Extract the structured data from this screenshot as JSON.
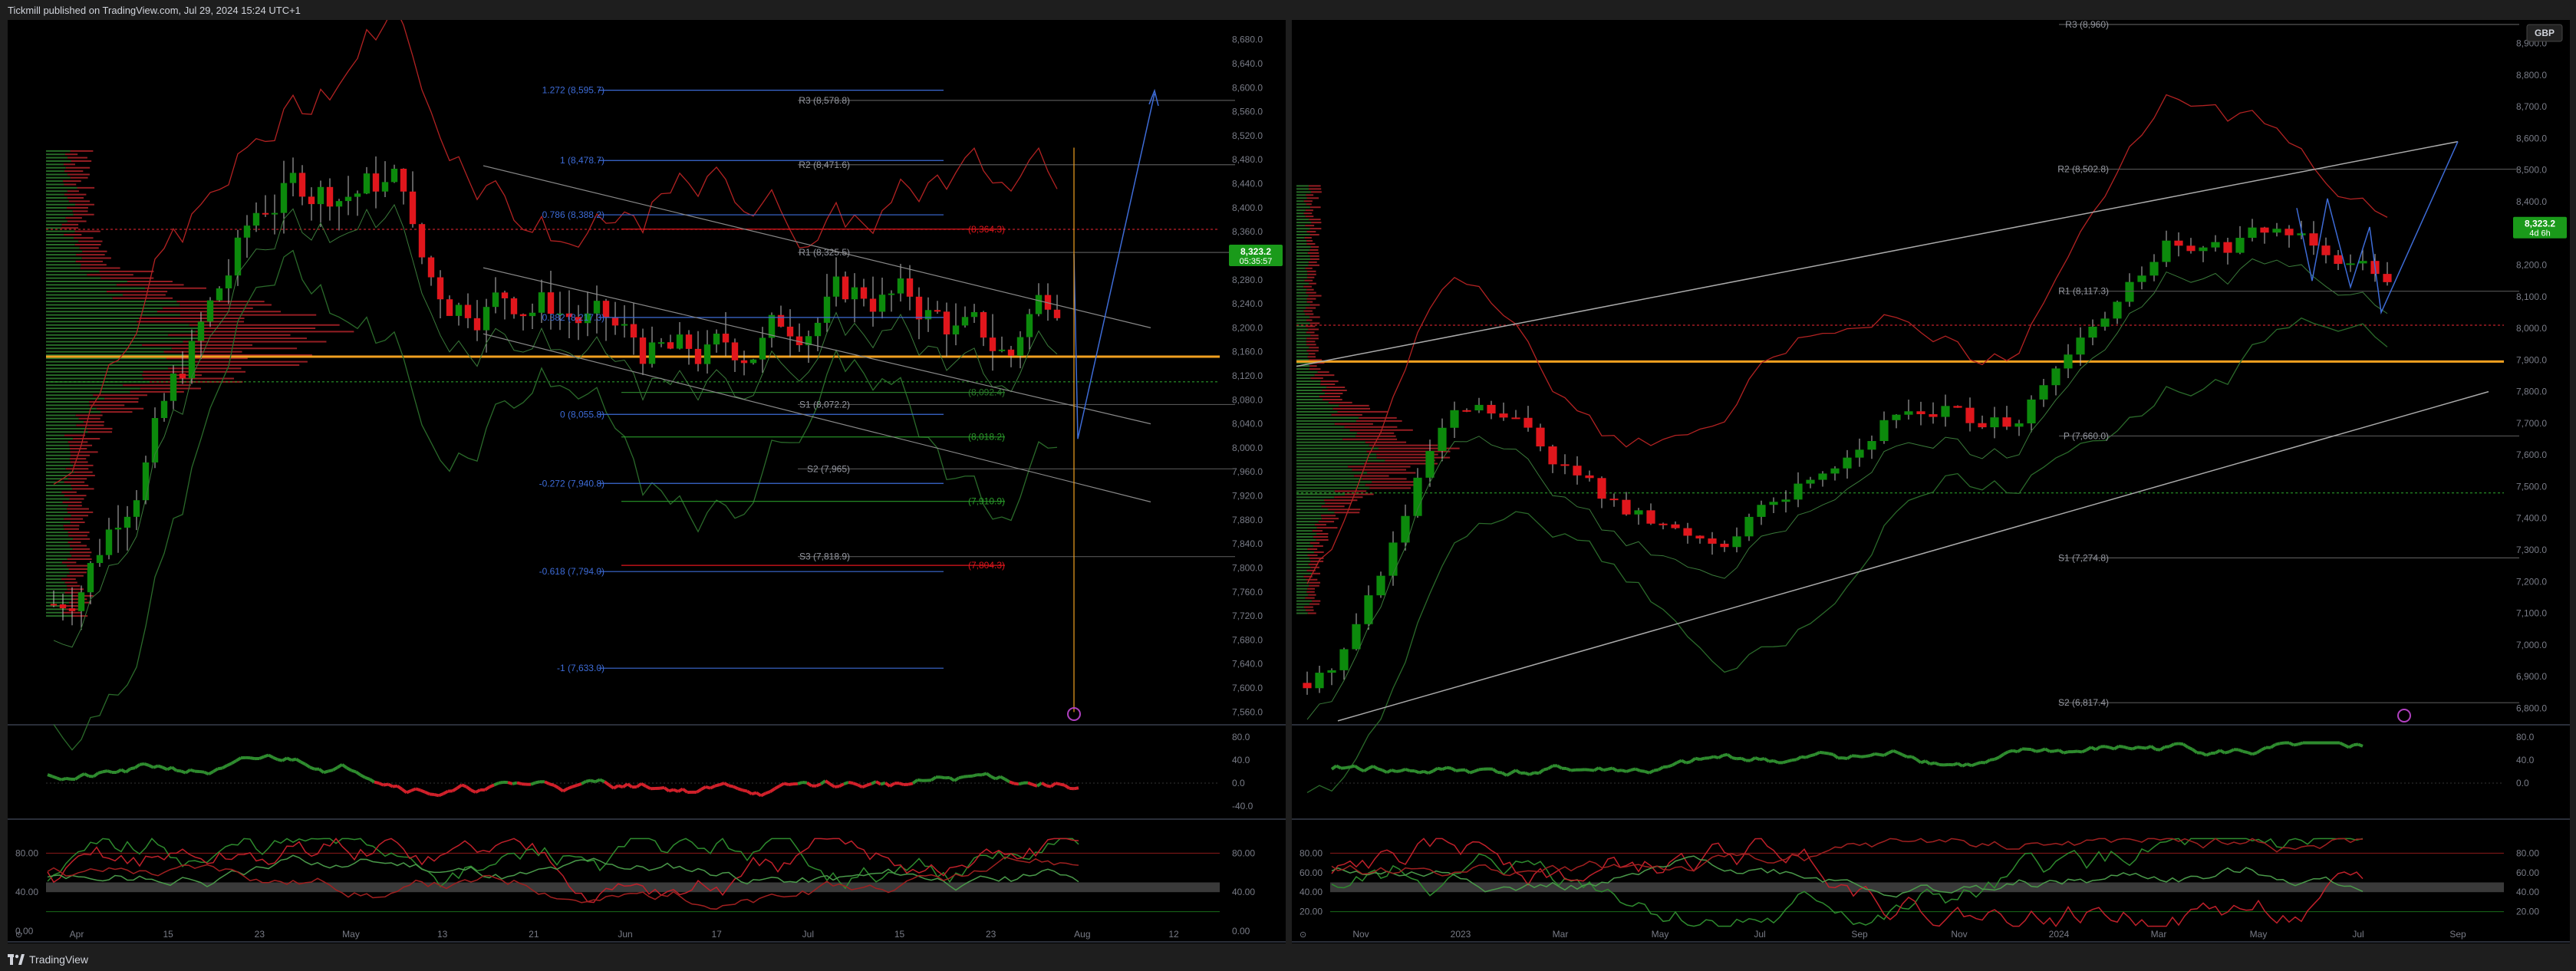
{
  "header": {
    "published": "Tickmill published on TradingView.com, Jul 29, 2024 15:24 UTC+1"
  },
  "footer": {
    "brand": "TradingView"
  },
  "colors": {
    "bull": "#0c8a0c",
    "bear": "#e0161c",
    "accent_orange": "#f0a020",
    "fib_blue": "#3d6bd6",
    "price_badge": "#1a9a1a",
    "background": "#000000"
  },
  "left_chart": {
    "price_axis": [
      "8,680.0",
      "8,640.0",
      "8,600.0",
      "8,560.0",
      "8,520.0",
      "8,480.0",
      "8,440.0",
      "8,400.0",
      "8,360.0",
      "8,320.0",
      "8,280.0",
      "8,240.0",
      "8,200.0",
      "8,160.0",
      "8,120.0",
      "8,080.0",
      "8,040.0",
      "8,000.0",
      "7,960.0",
      "7,920.0",
      "7,880.0",
      "7,840.0",
      "7,800.0",
      "7,760.0",
      "7,720.0",
      "7,680.0",
      "7,640.0",
      "7,600.0",
      "7,560.0"
    ],
    "price_min": 7540,
    "price_max": 8700,
    "time_axis": [
      "Apr",
      "15",
      "23",
      "May",
      "13",
      "21",
      "Jun",
      "17",
      "Jul",
      "15",
      "23",
      "Aug",
      "12"
    ],
    "last_price": "8,323.2",
    "countdown": "05:35:57",
    "pivots": [
      {
        "label": "R3 (8,578.8)",
        "value": 8578.8
      },
      {
        "label": "R2 (8,471.6)",
        "value": 8471.6
      },
      {
        "label": "R1 (8,325.5)",
        "value": 8325.5
      },
      {
        "label": "S1 (8,072.2)",
        "value": 8072.2
      },
      {
        "label": "S2 (7,965)",
        "value": 7965
      },
      {
        "label": "S3 (7,818.9)",
        "value": 7818.9
      }
    ],
    "fibs": [
      {
        "label": "1.272 (8,595.7)",
        "value": 8595.7
      },
      {
        "label": "1 (8,478.7)",
        "value": 8478.7
      },
      {
        "label": "0.786 (8,388.2)",
        "value": 8388.2
      },
      {
        "label": "0.382 (8,217.3)",
        "value": 8217.3
      },
      {
        "label": "0 (8,055.8)",
        "value": 8055.8
      },
      {
        "label": "-0.272 (7,940.8)",
        "value": 7940.8
      },
      {
        "label": "-0.618 (7,794.0)",
        "value": 7794.0
      },
      {
        "label": "-1 (7,633.0)",
        "value": 7633.0
      }
    ],
    "extra_levels": [
      {
        "label": "(8,364.3)",
        "value": 8364.3,
        "color": "#e0161c"
      },
      {
        "label": "(8,092.4)",
        "value": 8092.4,
        "color": "#2a7a2a"
      },
      {
        "label": "(8,018.2)",
        "value": 8018.2,
        "color": "#2a9a2a"
      },
      {
        "label": "(7,910.9)",
        "value": 7910.9,
        "color": "#2a9a2a"
      },
      {
        "label": "(7,804.3)",
        "value": 7804.3,
        "color": "#e0161c"
      }
    ],
    "rsi_axis": [
      "80.0",
      "40.0",
      "0.0",
      "-40.0"
    ],
    "stoch_axis": [
      "80.00",
      "40.00",
      "0.00"
    ]
  },
  "right_chart": {
    "price_axis": [
      "8,900.0",
      "8,800.0",
      "8,700.0",
      "8,600.0",
      "8,500.0",
      "8,400.0",
      "8,300.0",
      "8,200.0",
      "8,100.0",
      "8,000.0",
      "7,900.0",
      "7,800.0",
      "7,700.0",
      "7,600.0",
      "7,500.0",
      "7,400.0",
      "7,300.0",
      "7,200.0",
      "7,100.0",
      "7,000.0",
      "6,900.0",
      "6,800.0"
    ],
    "price_min": 6750,
    "price_max": 8950,
    "time_axis": [
      "Nov",
      "2023",
      "Mar",
      "May",
      "Jul",
      "Sep",
      "Nov",
      "2024",
      "Mar",
      "May",
      "Jul",
      "Sep"
    ],
    "currency": "GBP",
    "last_price": "8,323.2",
    "countdown": "4d 6h",
    "pivots": [
      {
        "label": "R3 (8,960)",
        "value": 8960
      },
      {
        "label": "R2 (8,502.8)",
        "value": 8502.8
      },
      {
        "label": "R1 (8,117.3)",
        "value": 8117.3
      },
      {
        "label": "P (7,660.0)",
        "value": 7660.0
      },
      {
        "label": "S1 (7,274.8)",
        "value": 7274.8
      },
      {
        "label": "S2 (6,817.4)",
        "value": 6817.4
      }
    ],
    "rsi_axis": [
      "80.0",
      "40.0",
      "0.0"
    ],
    "stoch_axis": [
      "80.00",
      "60.00",
      "40.00",
      "20.00"
    ]
  }
}
